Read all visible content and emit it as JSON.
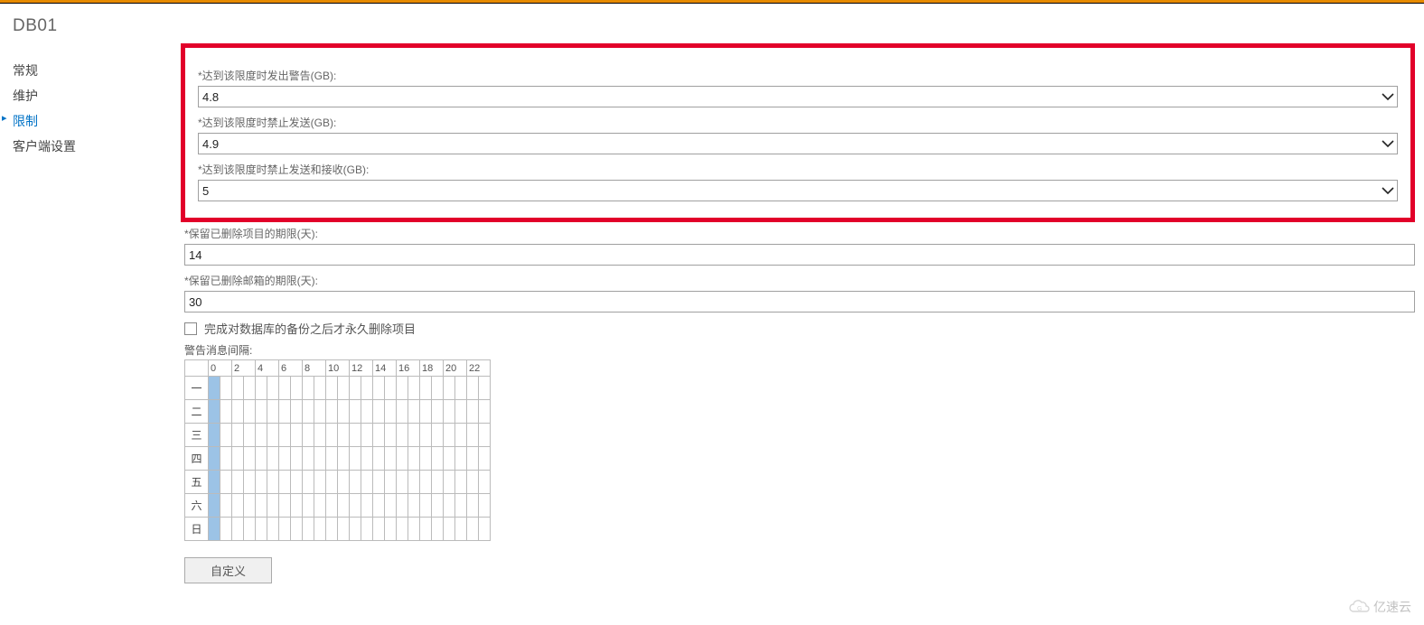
{
  "header": {
    "title": "DB01"
  },
  "sidebar": {
    "items": [
      {
        "label": "常规",
        "active": false
      },
      {
        "label": "维护",
        "active": false
      },
      {
        "label": "限制",
        "active": true
      },
      {
        "label": "客户端设置",
        "active": false
      }
    ]
  },
  "form": {
    "warn_label": "*达到该限度时发出警告(GB):",
    "warn_value": "4.8",
    "prohibit_send_label": "*达到该限度时禁止发送(GB):",
    "prohibit_send_value": "4.9",
    "prohibit_send_receive_label": "*达到该限度时禁止发送和接收(GB):",
    "prohibit_send_receive_value": "5",
    "keep_deleted_items_label": "*保留已删除项目的期限(天):",
    "keep_deleted_items_value": "14",
    "keep_deleted_mailbox_label": "*保留已删除邮箱的期限(天):",
    "keep_deleted_mailbox_value": "30",
    "backup_checkbox_label": "完成对数据库的备份之后才永久删除项目",
    "backup_checkbox_checked": false,
    "interval_label": "警告消息间隔:",
    "customize_button": "自定义"
  },
  "schedule": {
    "hours": [
      "0",
      "2",
      "4",
      "6",
      "8",
      "10",
      "12",
      "14",
      "16",
      "18",
      "20",
      "22"
    ],
    "days": [
      "一",
      "二",
      "三",
      "四",
      "五",
      "六",
      "日"
    ]
  },
  "watermark": {
    "text": "亿速云"
  }
}
